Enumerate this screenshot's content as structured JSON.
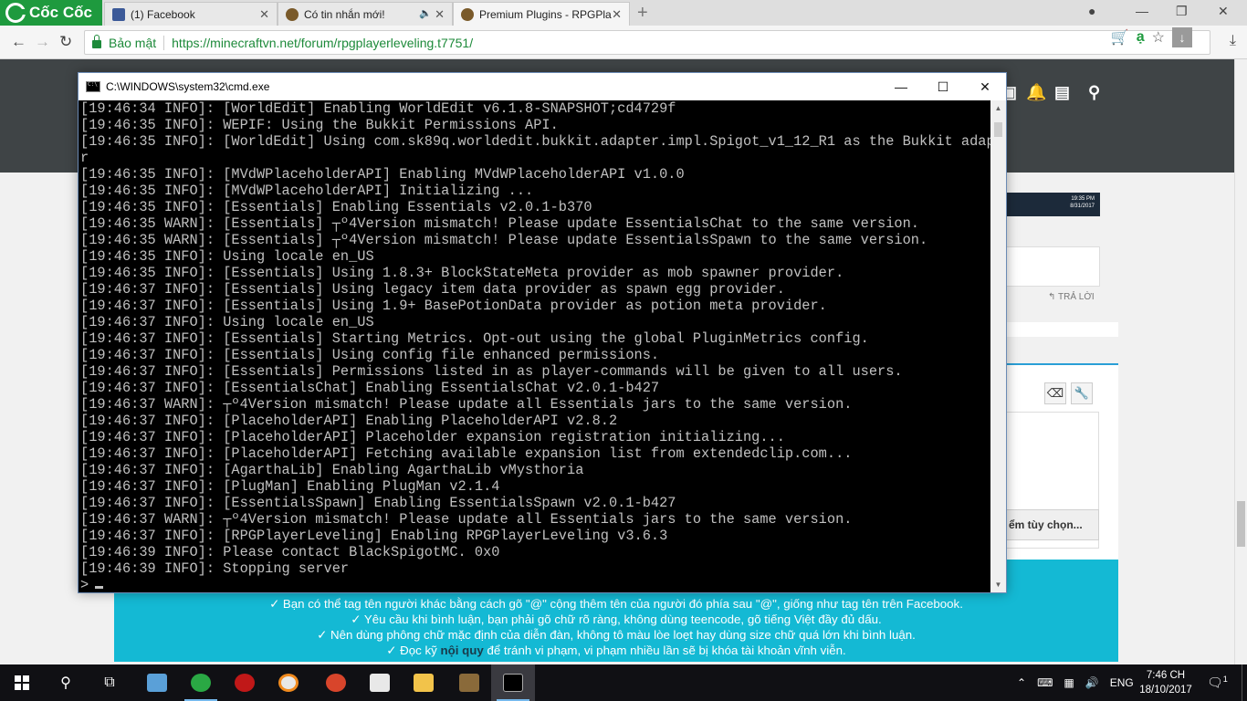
{
  "browser": {
    "brand": "Cốc Cốc",
    "tabs": [
      {
        "title": "(1) Facebook",
        "favicon_color": "#3b5998"
      },
      {
        "title": "Có tin nhắn mới!",
        "favicon_color": "#7a5a2a"
      },
      {
        "title": "Premium Plugins - RPGPla",
        "favicon_color": "#7a5a2a"
      }
    ],
    "security_label": "Bảo mật",
    "url": "https://minecraftvn.net/forum/rpgplayerleveling.t7751/"
  },
  "page": {
    "reply_label": "TRẢ LỜI",
    "custom_button": "ểm tùy chọn...",
    "thumb_time": "19:35 PM",
    "thumb_date": "8/31/2017",
    "rules": [
      "✓ Bạn có thể tag tên người khác bằng cách gõ \"@\" cộng thêm tên của người đó phía sau \"@\", giống như tag tên trên Facebook.",
      "✓ Yêu cầu khi bình luận, bạn phải gõ chữ rõ ràng, không dùng teencode, gõ tiếng Việt đầy đủ dấu.",
      "✓ Nên dùng phông chữ mặc định của diễn đàn, không tô màu lòe loẹt hay dùng size chữ quá lớn khi bình luận."
    ],
    "rule4_before": "✓ Đọc kỹ ",
    "rule4_link": "nội quy",
    "rule4_after": " để tránh vi phạm, vi phạm nhiều lần sẽ bị khóa tài khoản vĩnh viễn."
  },
  "cmd": {
    "title": "C:\\WINDOWS\\system32\\cmd.exe",
    "lines": [
      "[19:46:34 INFO]: [WorldEdit] Enabling WorldEdit v6.1.8-SNAPSHOT;cd4729f",
      "[19:46:35 INFO]: WEPIF: Using the Bukkit Permissions API.",
      "[19:46:35 INFO]: [WorldEdit] Using com.sk89q.worldedit.bukkit.adapter.impl.Spigot_v1_12_R1 as the Bukkit adapte",
      "r",
      "[19:46:35 INFO]: [MVdWPlaceholderAPI] Enabling MVdWPlaceholderAPI v1.0.0",
      "[19:46:35 INFO]: [MVdWPlaceholderAPI] Initializing ...",
      "[19:46:35 INFO]: [Essentials] Enabling Essentials v2.0.1-b370",
      "[19:46:35 WARN]: [Essentials] ┬º4Version mismatch! Please update EssentialsChat to the same version.",
      "[19:46:35 WARN]: [Essentials] ┬º4Version mismatch! Please update EssentialsSpawn to the same version.",
      "[19:46:35 INFO]: Using locale en_US",
      "[19:46:35 INFO]: [Essentials] Using 1.8.3+ BlockStateMeta provider as mob spawner provider.",
      "[19:46:37 INFO]: [Essentials] Using legacy item data provider as spawn egg provider.",
      "[19:46:37 INFO]: [Essentials] Using 1.9+ BasePotionData provider as potion meta provider.",
      "[19:46:37 INFO]: Using locale en_US",
      "[19:46:37 INFO]: [Essentials] Starting Metrics. Opt-out using the global PluginMetrics config.",
      "[19:46:37 INFO]: [Essentials] Using config file enhanced permissions.",
      "[19:46:37 INFO]: [Essentials] Permissions listed in as player-commands will be given to all users.",
      "[19:46:37 INFO]: [EssentialsChat] Enabling EssentialsChat v2.0.1-b427",
      "[19:46:37 WARN]: ┬º4Version mismatch! Please update all Essentials jars to the same version.",
      "[19:46:37 INFO]: [PlaceholderAPI] Enabling PlaceholderAPI v2.8.2",
      "[19:46:37 INFO]: [PlaceholderAPI] Placeholder expansion registration initializing...",
      "[19:46:37 INFO]: [PlaceholderAPI] Fetching available expansion list from extendedclip.com...",
      "[19:46:37 INFO]: [AgarthaLib] Enabling AgarthaLib vMysthoria",
      "[19:46:37 INFO]: [PlugMan] Enabling PlugMan v2.1.4",
      "[19:46:37 INFO]: [EssentialsSpawn] Enabling EssentialsSpawn v2.0.1-b427",
      "[19:46:37 WARN]: ┬º4Version mismatch! Please update all Essentials jars to the same version.",
      "[19:46:37 INFO]: [RPGPlayerLeveling] Enabling RPGPlayerLeveling v3.6.3",
      "[19:46:39 INFO]: Please contact BlackSpigotMC. 0x0",
      "[19:46:39 INFO]: Stopping server",
      ">"
    ]
  },
  "taskbar": {
    "language": "ENG",
    "time": "7:46 CH",
    "date": "18/10/2017",
    "notification_count": "1"
  }
}
